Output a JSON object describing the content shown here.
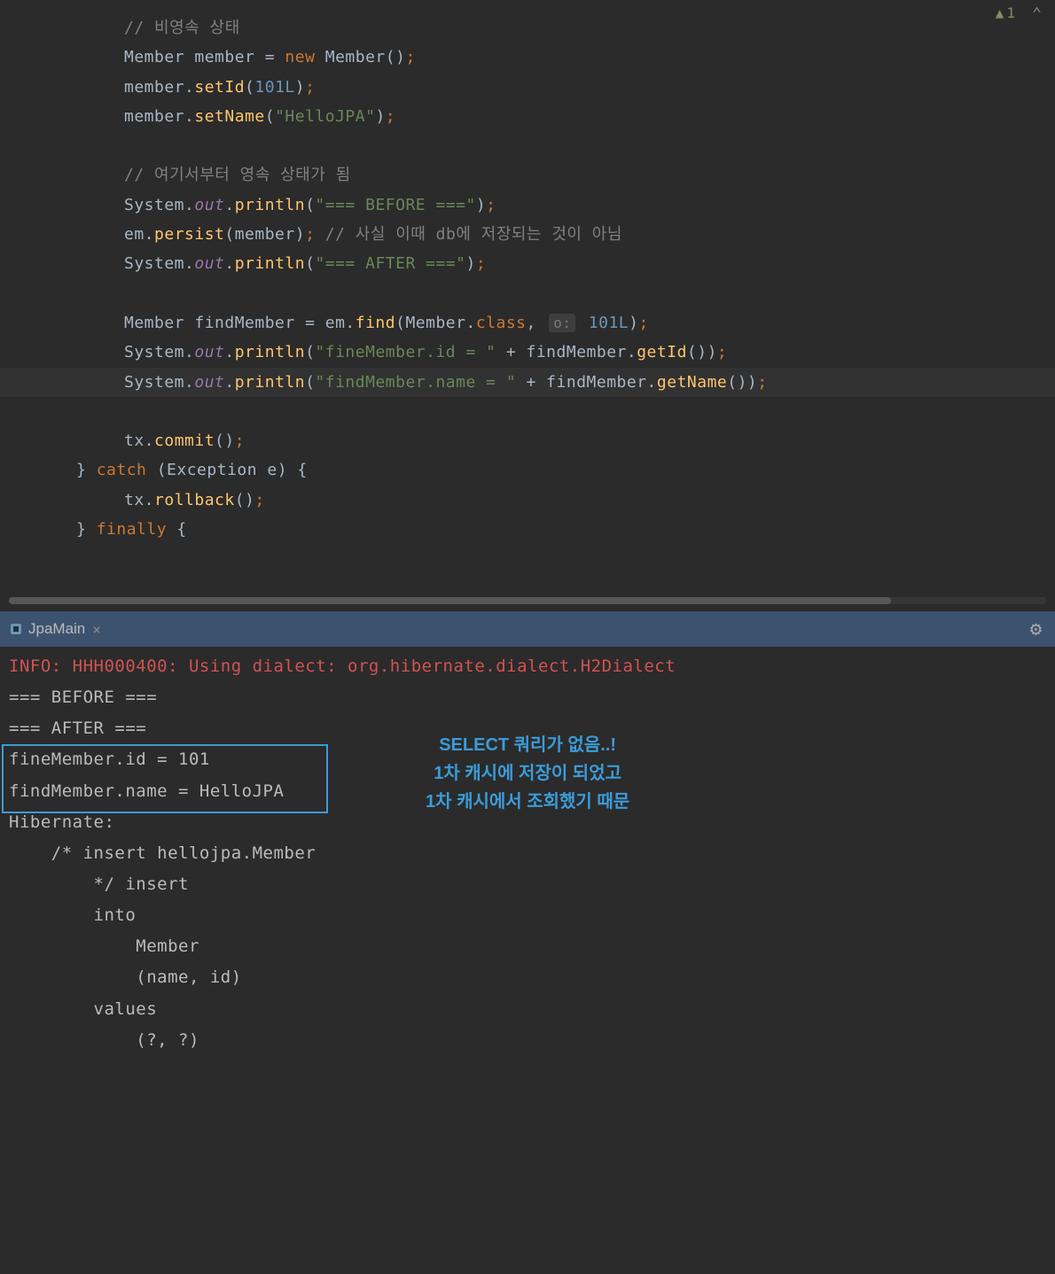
{
  "warning": {
    "count": "1"
  },
  "code": {
    "c1": "// 비영속 상태",
    "l2_1": "Member member = ",
    "l2_new": "new",
    "l2_2": " Member()",
    "l2_semi": ";",
    "l3_1": "member.",
    "l3_m": "setId",
    "l3_2": "(",
    "l3_n": "101L",
    "l3_3": ")",
    "l3_semi": ";",
    "l4_1": "member.",
    "l4_m": "setName",
    "l4_2": "(",
    "l4_s": "\"HelloJPA\"",
    "l4_3": ")",
    "l4_semi": ";",
    "c2": "// 여기서부터 영속 상태가 됨",
    "l6_1": "System.",
    "l6_f": "out",
    "l6_2": ".",
    "l6_m": "println",
    "l6_3": "(",
    "l6_s": "\"=== BEFORE ===\"",
    "l6_4": ")",
    "l6_semi": ";",
    "l7_1": "em.",
    "l7_m": "persist",
    "l7_2": "(member)",
    "l7_semi": ";",
    "l7_c": " // 사실 이때 db에 저장되는 것이 아님",
    "l8_1": "System.",
    "l8_f": "out",
    "l8_2": ".",
    "l8_m": "println",
    "l8_3": "(",
    "l8_s": "\"=== AFTER ===\"",
    "l8_4": ")",
    "l8_semi": ";",
    "l9_1": "Member findMember = em.",
    "l9_m": "find",
    "l9_2": "(Member.",
    "l9_k": "class",
    "l9_3": ", ",
    "l9_hint": "o:",
    "l9_n": " 101L",
    "l9_4": ")",
    "l9_semi": ";",
    "l10_1": "System.",
    "l10_f": "out",
    "l10_2": ".",
    "l10_m": "println",
    "l10_3": "(",
    "l10_s": "\"fineMember.id = \"",
    "l10_4": " + findMember.",
    "l10_m2": "getId",
    "l10_5": "())",
    "l10_semi": ";",
    "l11_1": "System.",
    "l11_f": "out",
    "l11_2": ".",
    "l11_m": "println",
    "l11_3": "(",
    "l11_s": "\"findMember.name = \"",
    "l11_4": " + findMember.",
    "l11_m2": "getName",
    "l11_5": "())",
    "l11_semi": ";",
    "l12_1": "tx.",
    "l12_m": "commit",
    "l12_2": "()",
    "l12_semi": ";",
    "l13_1": "} ",
    "l13_k": "catch",
    "l13_2": " (Exception e) {",
    "l14_1": "tx.",
    "l14_m": "rollback",
    "l14_2": "()",
    "l14_semi": ";",
    "l15_1": "} ",
    "l15_k": "finally",
    "l15_2": " {"
  },
  "tab": {
    "label": "JpaMain",
    "close": "×"
  },
  "console": {
    "l1_a": "INFO:",
    "l1_b": " HHH000400: Using dialect: org.hibernate.dialect.H2Dialect",
    "l2": "=== BEFORE ===",
    "l3": "=== AFTER ===",
    "l4": "fineMember.id = 101",
    "l5": "findMember.name = HelloJPA",
    "l6": "Hibernate: ",
    "l7": "    /* insert hellojpa.Member",
    "l8": "        */ insert ",
    "l9": "        into",
    "l10": "            Member",
    "l11": "            (name, id) ",
    "l12": "        values",
    "l13": "            (?, ?)"
  },
  "annotation": {
    "l1": "SELECT 쿼리가 없음..!",
    "l2": "1차 캐시에 저장이 되었고",
    "l3": "1차 캐시에서 조회했기 때문"
  }
}
